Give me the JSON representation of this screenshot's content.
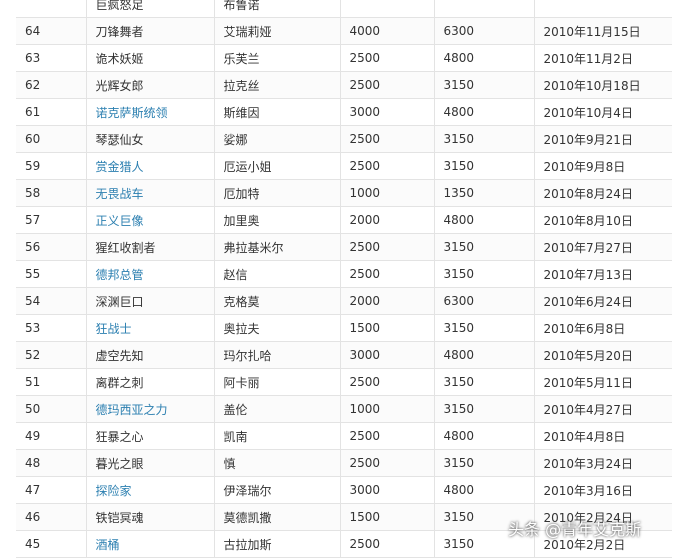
{
  "table": {
    "rows": [
      {
        "id": "",
        "name": "巨疯怒足",
        "alias": "布鲁诺",
        "ip": "",
        "rp": "",
        "date": "",
        "link": false
      },
      {
        "id": "64",
        "name": "刀锋舞者",
        "alias": "艾瑞莉娅",
        "ip": "4000",
        "rp": "6300",
        "date": "2010年11月15日",
        "link": false
      },
      {
        "id": "63",
        "name": "诡术妖姬",
        "alias": "乐芙兰",
        "ip": "2500",
        "rp": "4800",
        "date": "2010年11月2日",
        "link": false
      },
      {
        "id": "62",
        "name": "光辉女郎",
        "alias": "拉克丝",
        "ip": "2500",
        "rp": "3150",
        "date": "2010年10月18日",
        "link": false
      },
      {
        "id": "61",
        "name": "诺克萨斯统领",
        "alias": "斯维因",
        "ip": "3000",
        "rp": "4800",
        "date": "2010年10月4日",
        "link": true
      },
      {
        "id": "60",
        "name": "琴瑟仙女",
        "alias": "娑娜",
        "ip": "2500",
        "rp": "3150",
        "date": "2010年9月21日",
        "link": false
      },
      {
        "id": "59",
        "name": "赏金猎人",
        "alias": "厄运小姐",
        "ip": "2500",
        "rp": "3150",
        "date": "2010年9月8日",
        "link": true
      },
      {
        "id": "58",
        "name": "无畏战车",
        "alias": "厄加特",
        "ip": "1000",
        "rp": "1350",
        "date": "2010年8月24日",
        "link": true
      },
      {
        "id": "57",
        "name": "正义巨像",
        "alias": "加里奥",
        "ip": "2000",
        "rp": "4800",
        "date": "2010年8月10日",
        "link": true
      },
      {
        "id": "56",
        "name": "猩红收割者",
        "alias": "弗拉基米尔",
        "ip": "2500",
        "rp": "3150",
        "date": "2010年7月27日",
        "link": false
      },
      {
        "id": "55",
        "name": "德邦总管",
        "alias": "赵信",
        "ip": "2500",
        "rp": "3150",
        "date": "2010年7月13日",
        "link": true
      },
      {
        "id": "54",
        "name": "深渊巨口",
        "alias": "克格莫",
        "ip": "2000",
        "rp": "6300",
        "date": "2010年6月24日",
        "link": false
      },
      {
        "id": "53",
        "name": "狂战士",
        "alias": "奥拉夫",
        "ip": "1500",
        "rp": "3150",
        "date": "2010年6月8日",
        "link": true
      },
      {
        "id": "52",
        "name": "虚空先知",
        "alias": "玛尔扎哈",
        "ip": "3000",
        "rp": "4800",
        "date": "2010年5月20日",
        "link": false
      },
      {
        "id": "51",
        "name": "离群之刺",
        "alias": "阿卡丽",
        "ip": "2500",
        "rp": "3150",
        "date": "2010年5月11日",
        "link": false
      },
      {
        "id": "50",
        "name": "德玛西亚之力",
        "alias": "盖伦",
        "ip": "1000",
        "rp": "3150",
        "date": "2010年4月27日",
        "link": true
      },
      {
        "id": "49",
        "name": "狂暴之心",
        "alias": "凯南",
        "ip": "2500",
        "rp": "4800",
        "date": "2010年4月8日",
        "link": false
      },
      {
        "id": "48",
        "name": "暮光之眼",
        "alias": "慎",
        "ip": "2500",
        "rp": "3150",
        "date": "2010年3月24日",
        "link": false
      },
      {
        "id": "47",
        "name": "探险家",
        "alias": "伊泽瑞尔",
        "ip": "3000",
        "rp": "4800",
        "date": "2010年3月16日",
        "link": true
      },
      {
        "id": "46",
        "name": "铁铠冥魂",
        "alias": "莫德凯撒",
        "ip": "1500",
        "rp": "3150",
        "date": "2010年2月24日",
        "link": false
      },
      {
        "id": "45",
        "name": "酒桶",
        "alias": "古拉加斯",
        "ip": "2500",
        "rp": "3150",
        "date": "2010年2月2日",
        "link": true
      }
    ]
  },
  "watermark": {
    "text": "头条 @青年艾克斯"
  },
  "colors": {
    "link": "#2b7fb0",
    "text": "#333333",
    "border": "#e3e3e3"
  }
}
